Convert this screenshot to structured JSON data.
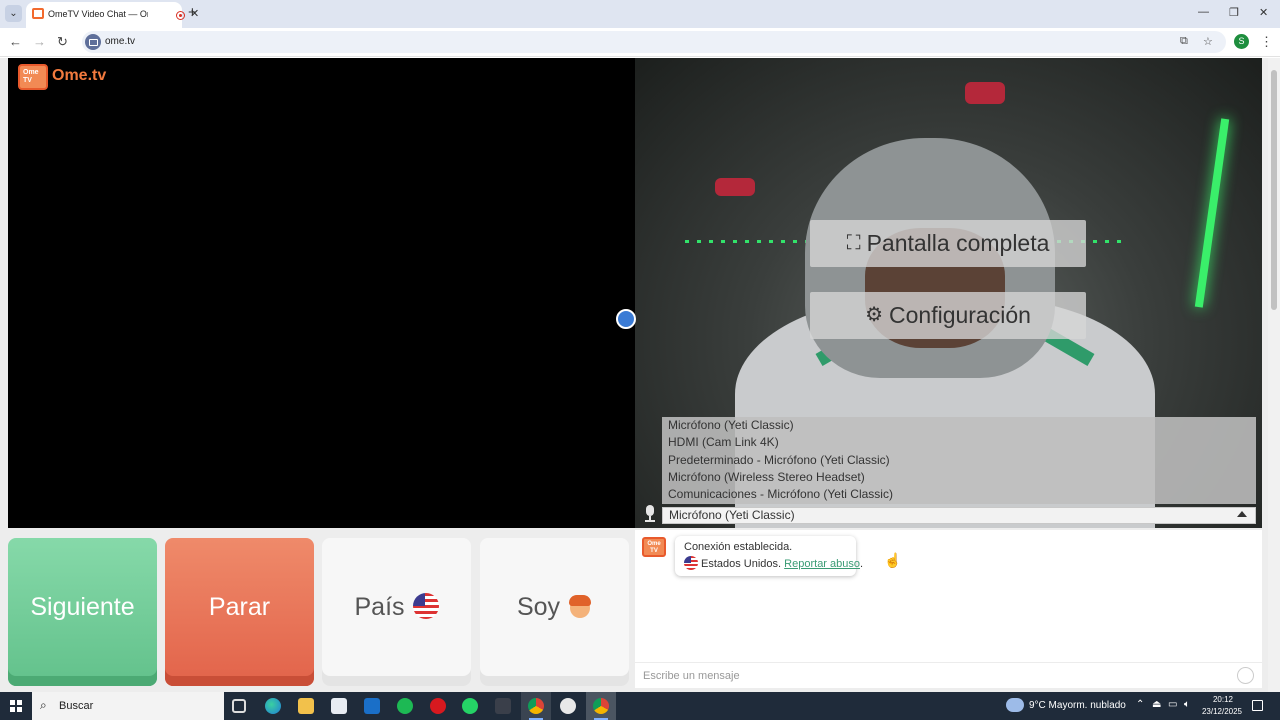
{
  "browser": {
    "tab_title": "OmeTV Video Chat — Ome",
    "close_glyph": "✕",
    "new_tab_glyph": "+",
    "url": "ome.tv",
    "profile_initial": "S",
    "window_controls": [
      "—",
      "❐",
      "✕"
    ]
  },
  "page": {
    "logo": {
      "badge": "Ome TV",
      "text": "Ome.tv"
    },
    "overlay_buttons": {
      "fullscreen": "Pantalla completa",
      "settings": "Configuración"
    },
    "mic_devices": [
      "Micrófono (Yeti Classic)",
      "HDMI (Cam Link 4K)",
      "Predeterminado - Micrófono (Yeti Classic)",
      "Micrófono (Wireless Stereo Headset)",
      "Comunicaciones - Micrófono (Yeti Classic)"
    ],
    "mic_selected": "Micrófono (Yeti Classic)",
    "controls": {
      "next": "Siguiente",
      "stop": "Parar",
      "country": "País",
      "gender": "Soy"
    },
    "chat": {
      "logo_badge": "Ome TV",
      "status": "Conexión establecida.",
      "country": "Estados Unidos.",
      "report_link": "Reportar abuso",
      "report_suffix": ".",
      "placeholder": "Escribe un mensaje"
    }
  },
  "taskbar": {
    "search_placeholder": "Buscar",
    "weather": "9°C  Mayorm. nublado",
    "time": "20:12",
    "date": "23/12/2025"
  },
  "colors": {
    "next_button": "#62c18b",
    "stop_button": "#e2634a",
    "brand_orange": "#f27a3e",
    "report_link": "#3a9b74"
  }
}
